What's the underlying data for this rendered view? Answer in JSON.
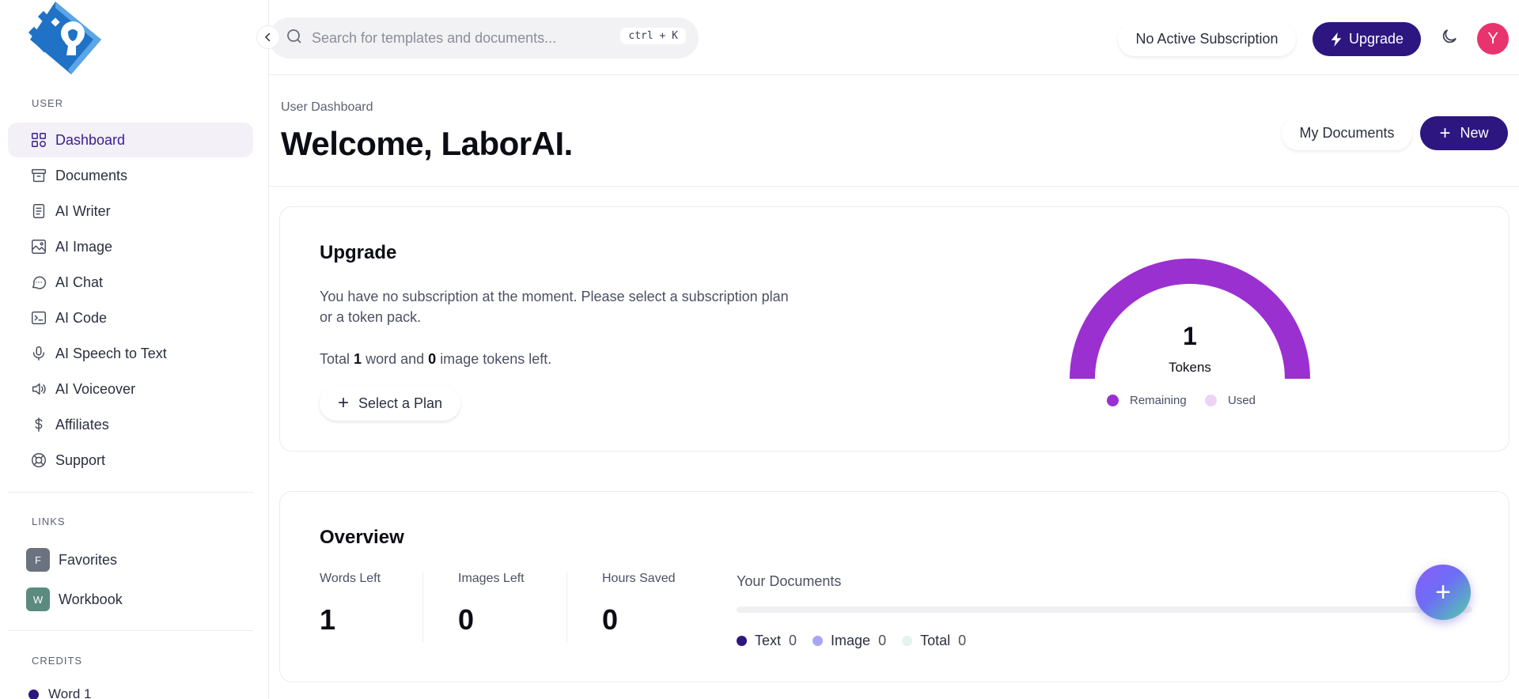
{
  "app": {
    "accent": "#2d1680",
    "gauge_color": "#9b30d0"
  },
  "sidebar": {
    "logo": "labor-ai-logo",
    "user_label": "USER",
    "items": [
      {
        "label": "Dashboard",
        "icon": "dashboard-icon",
        "active": true
      },
      {
        "label": "Documents",
        "icon": "archive-icon"
      },
      {
        "label": "AI Writer",
        "icon": "document-icon"
      },
      {
        "label": "AI Image",
        "icon": "image-icon"
      },
      {
        "label": "AI Chat",
        "icon": "chat-icon"
      },
      {
        "label": "AI Code",
        "icon": "terminal-icon"
      },
      {
        "label": "AI Speech to Text",
        "icon": "microphone-icon"
      },
      {
        "label": "AI Voiceover",
        "icon": "speaker-icon"
      },
      {
        "label": "Affiliates",
        "icon": "dollar-icon"
      },
      {
        "label": "Support",
        "icon": "lifebuoy-icon"
      }
    ],
    "links_label": "LINKS",
    "links": [
      {
        "badge": "F",
        "label": "Favorites",
        "color": "#6b7280"
      },
      {
        "badge": "W",
        "label": "Workbook",
        "color": "#5b8a7e"
      }
    ],
    "credits_label": "CREDITS",
    "credits": [
      {
        "label": "Word",
        "value": "1"
      }
    ]
  },
  "topbar": {
    "search_placeholder": "Search for templates and documents...",
    "shortcut": "ctrl + K",
    "subscription_status": "No Active Subscription",
    "upgrade_label": "Upgrade",
    "avatar_initial": "Y"
  },
  "header": {
    "breadcrumb": "User Dashboard",
    "title": "Welcome, LaborAI.",
    "my_documents": "My Documents",
    "new_label": "New"
  },
  "upgrade_card": {
    "title": "Upgrade",
    "description": "You have no subscription at the moment. Please select a subscription plan or a token pack.",
    "total_prefix": "Total",
    "words": "1",
    "word_text": "word and",
    "images": "0",
    "image_text": "image tokens left.",
    "select_plan": "Select a Plan",
    "gauge": {
      "value": "1",
      "label": "Tokens",
      "legend": [
        {
          "label": "Remaining",
          "color": "#9b30d0"
        },
        {
          "label": "Used",
          "color": "#ecd3f5"
        }
      ],
      "remaining": 1,
      "used": 0
    }
  },
  "overview": {
    "title": "Overview",
    "stats": [
      {
        "label": "Words Left",
        "value": "1"
      },
      {
        "label": "Images Left",
        "value": "0"
      },
      {
        "label": "Hours Saved",
        "value": "0"
      }
    ],
    "documents_title": "Your Documents",
    "documents_legend": [
      {
        "label": "Text",
        "value": "0",
        "color": "#2d1680"
      },
      {
        "label": "Image",
        "value": "0",
        "color": "#a5a6f6"
      },
      {
        "label": "Total",
        "value": "0",
        "color": "#e3f3ee"
      }
    ]
  }
}
